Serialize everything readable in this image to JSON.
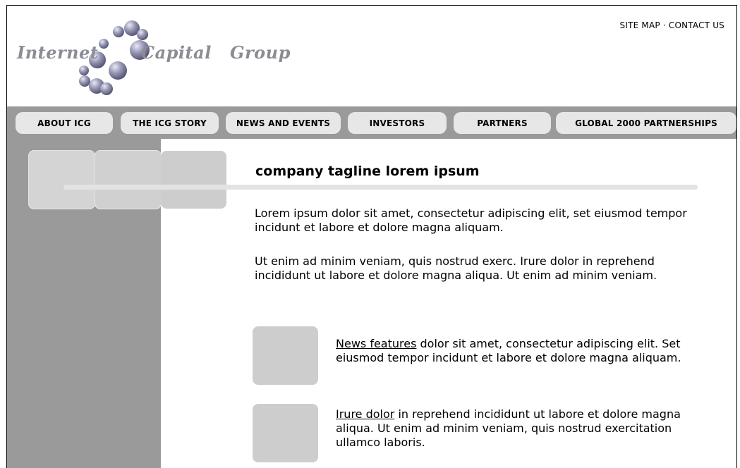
{
  "header": {
    "logo": {
      "word1": "Internet",
      "word2": "Capital",
      "word3": "Group"
    },
    "top_links": {
      "site_map": "SITE MAP",
      "separator": "·",
      "contact_us": "CONTACT US"
    }
  },
  "nav": {
    "tabs": [
      {
        "label": "ABOUT ICG"
      },
      {
        "label": "THE ICG STORY"
      },
      {
        "label": "NEWS AND EVENTS"
      },
      {
        "label": "INVESTORS"
      },
      {
        "label": "PARTNERS"
      },
      {
        "label": "GLOBAL 2000 PARTNERSHIPS"
      }
    ]
  },
  "main": {
    "tagline": "company tagline lorem ipsum",
    "paragraph1": "Lorem ipsum dolor sit amet, consectetur adipiscing elit, set eiusmod tempor incidunt et labore et dolore magna aliquam.",
    "paragraph2": "Ut enim ad minim veniam, quis nostrud exerc. Irure dolor in reprehend incididunt ut labore et dolore magna aliqua. Ut enim ad minim veniam.",
    "features": [
      {
        "link": "News features",
        "text": " dolor sit amet, consectetur adipiscing elit. Set eiusmod tempor incidunt et labore et dolore magna aliquam."
      },
      {
        "link": "Irure dolor",
        "text": " in reprehend incididunt ut labore et dolore magna aliqua. Ut enim ad minim veniam, quis nostrud exercitation ullamco laboris."
      }
    ]
  },
  "colors": {
    "nav_bar": "#9a9a9a",
    "tab_bg": "#e7e7e7",
    "placeholder": "#cdcdcd",
    "logo_text": "#8c8c95"
  }
}
